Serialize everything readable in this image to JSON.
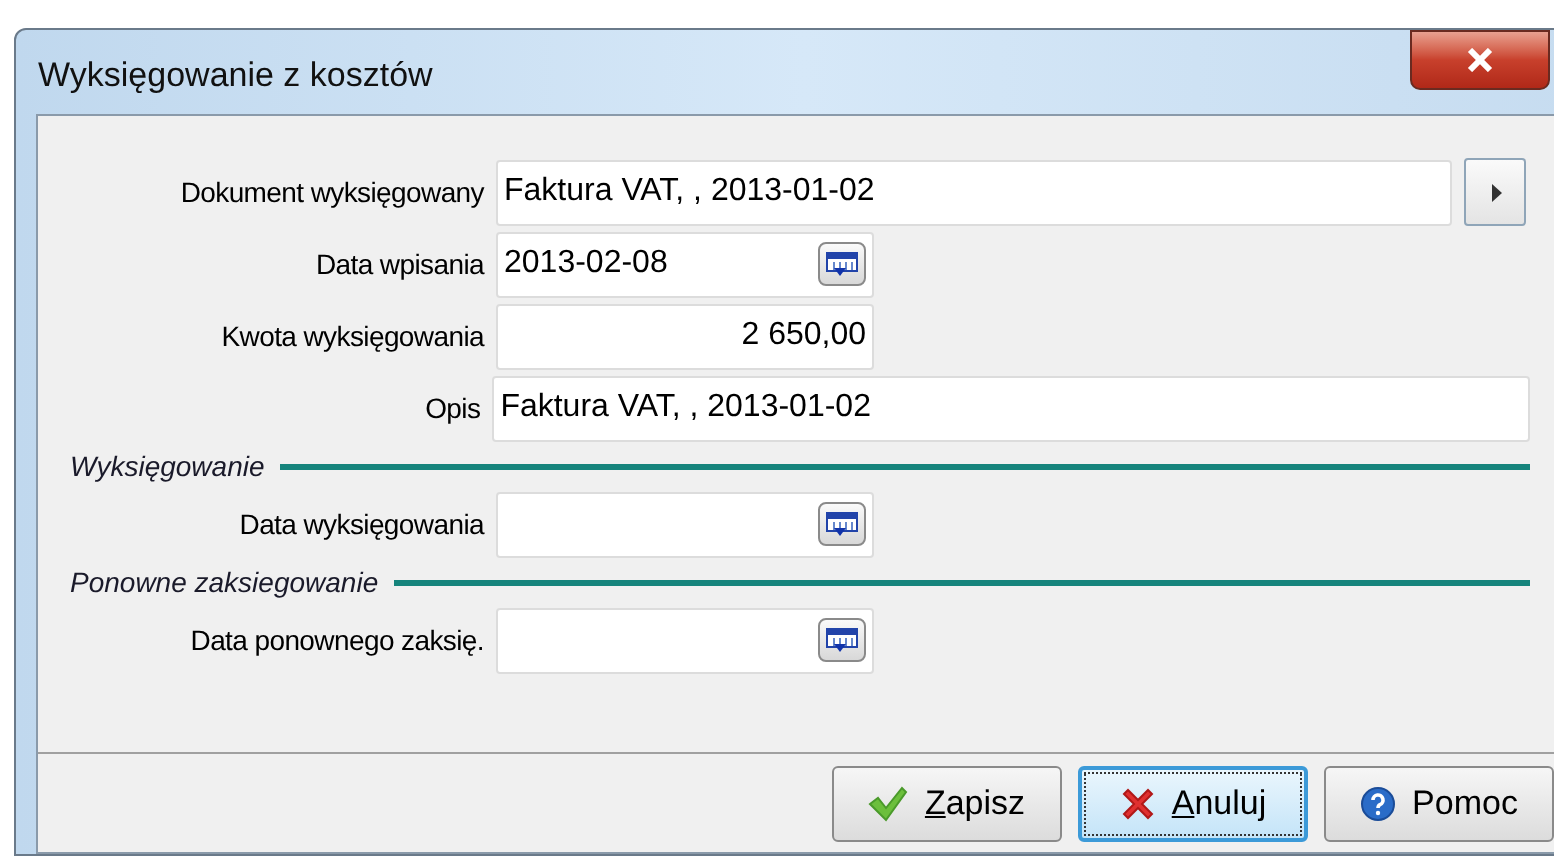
{
  "window": {
    "title": "Wyksięgowanie z kosztów"
  },
  "fields": [
    {
      "kind": "lookup",
      "label": "Dokument wyksięgowany",
      "value": "Faktura VAT, , 2013-01-02"
    },
    {
      "kind": "date",
      "label": "Data wpisania",
      "value": "2013-02-08"
    },
    {
      "kind": "amount",
      "label": "Kwota wyksięgowania",
      "value": "2 650,00"
    },
    {
      "kind": "wide",
      "label": "Opis",
      "value": "Faktura VAT, , 2013-01-02"
    },
    {
      "kind": "section",
      "label": "Wyksięgowanie"
    },
    {
      "kind": "date",
      "label": "Data wyksięgowania"
    },
    {
      "kind": "section",
      "label": "Ponowne zaksiegowanie"
    },
    {
      "kind": "date",
      "label": "Data ponownego zaksię."
    }
  ],
  "buttons": [
    {
      "kind": "save",
      "label": "Zapisz",
      "underline_first": true,
      "focused": false
    },
    {
      "kind": "cancel",
      "label": "Anuluj",
      "underline_first": true,
      "focused": true
    },
    {
      "kind": "help",
      "label": "Pomoc",
      "underline_first": false,
      "focused": false
    }
  ]
}
